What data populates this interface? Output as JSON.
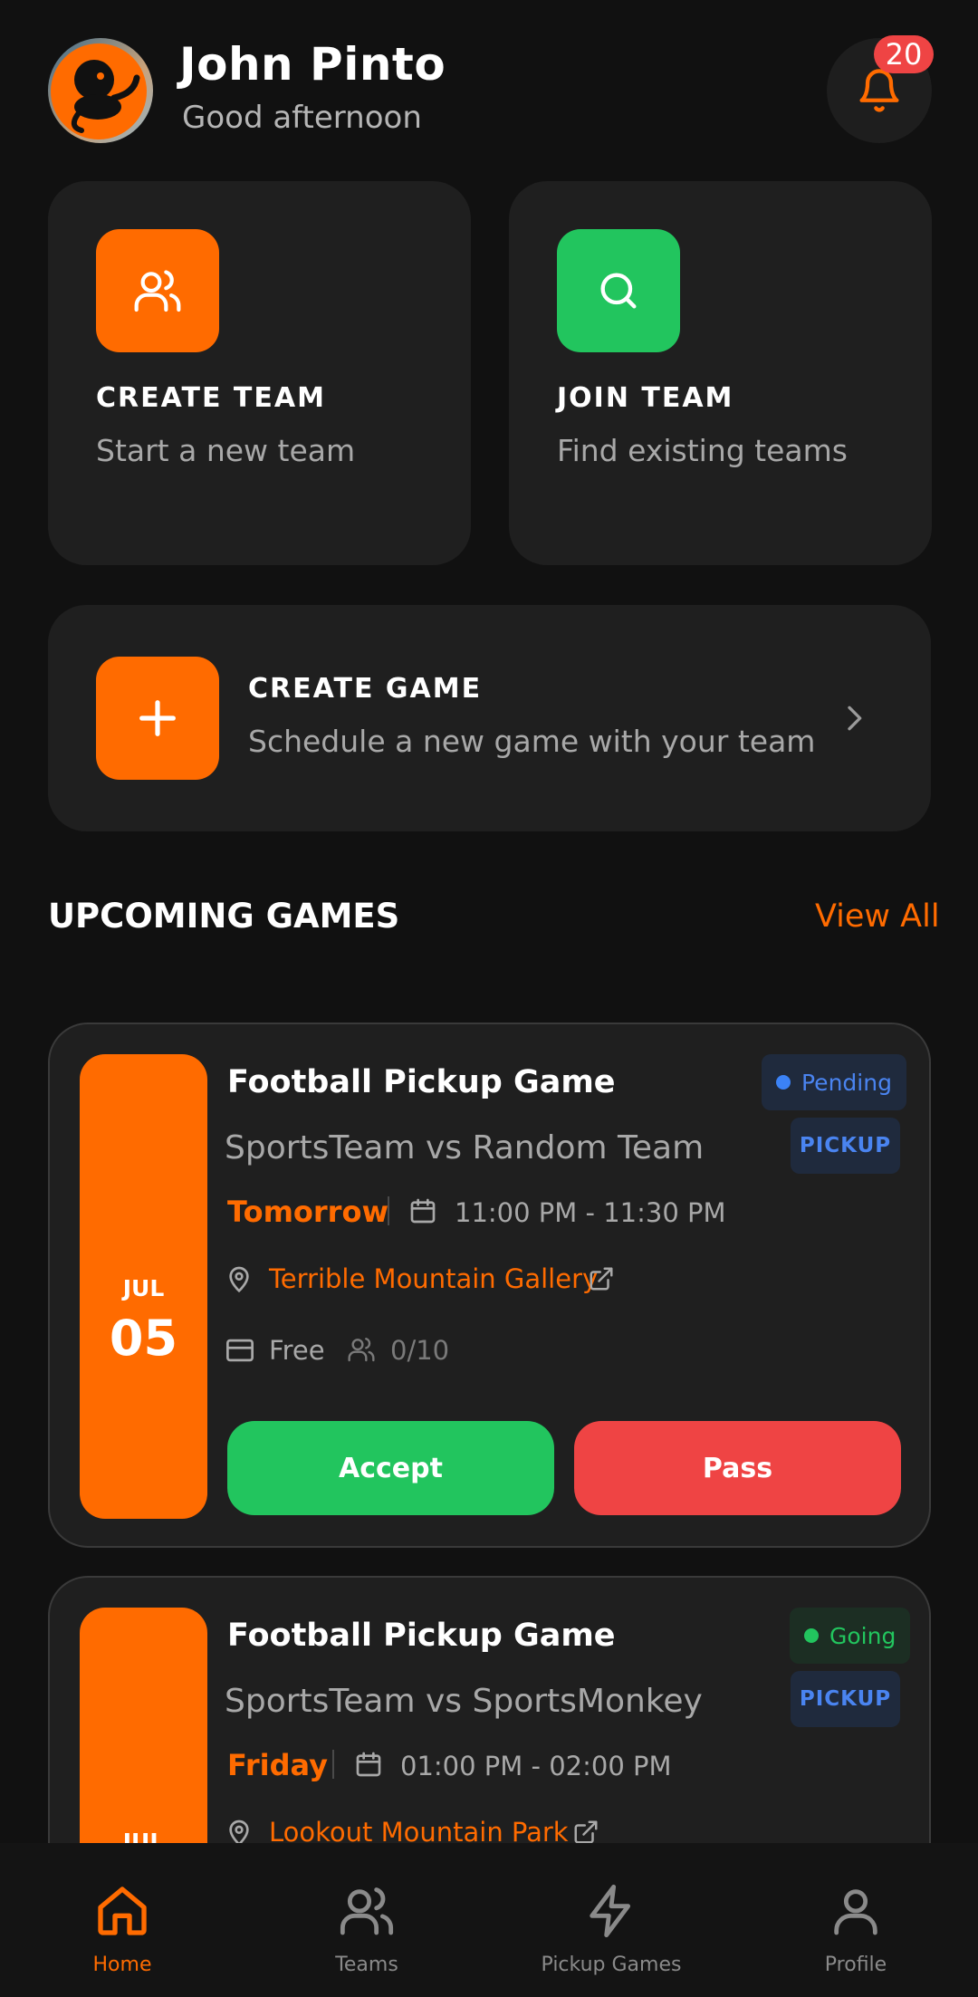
{
  "header": {
    "user_name": "John Pinto",
    "greeting": "Good afternoon",
    "notification_count": "20",
    "accent": "#ff6b00"
  },
  "actions": {
    "create_team": {
      "title": "CREATE TEAM",
      "subtitle": "Start a new team",
      "icon": "users-icon",
      "color": "#ff6b00"
    },
    "join_team": {
      "title": "JOIN TEAM",
      "subtitle": "Find existing teams",
      "icon": "search-icon",
      "color": "#22c55e"
    },
    "create_game": {
      "title": "CREATE GAME",
      "subtitle": "Schedule a new game with your team",
      "icon": "plus-icon",
      "color": "#ff6b00"
    }
  },
  "upcoming": {
    "title": "UPCOMING GAMES",
    "view_all": "View All",
    "games": [
      {
        "month": "JUL",
        "day": "05",
        "title": "Football Pickup Game",
        "teams": "SportsTeam vs Random Team",
        "when": "Tomorrow",
        "time": "11:00 PM - 11:30 PM",
        "location": "Terrible Mountain Gallery",
        "price": "Free",
        "slots": "0/10",
        "status": "Pending",
        "status_color": "#3b82f6",
        "type": "PICKUP",
        "accept_label": "Accept",
        "pass_label": "Pass"
      },
      {
        "month": "JUL",
        "title": "Football Pickup Game",
        "teams": "SportsTeam vs SportsMonkey",
        "when": "Friday",
        "time": "01:00 PM - 02:00 PM",
        "location": "Lookout Mountain Park",
        "status": "Going",
        "status_color": "#22c55e",
        "type": "PICKUP"
      }
    ]
  },
  "nav": {
    "items": [
      {
        "label": "Home",
        "icon": "home-icon",
        "active": true
      },
      {
        "label": "Teams",
        "icon": "users-icon",
        "active": false
      },
      {
        "label": "Pickup Games",
        "icon": "lightning-icon",
        "active": false
      },
      {
        "label": "Profile",
        "icon": "user-icon",
        "active": false
      }
    ]
  }
}
